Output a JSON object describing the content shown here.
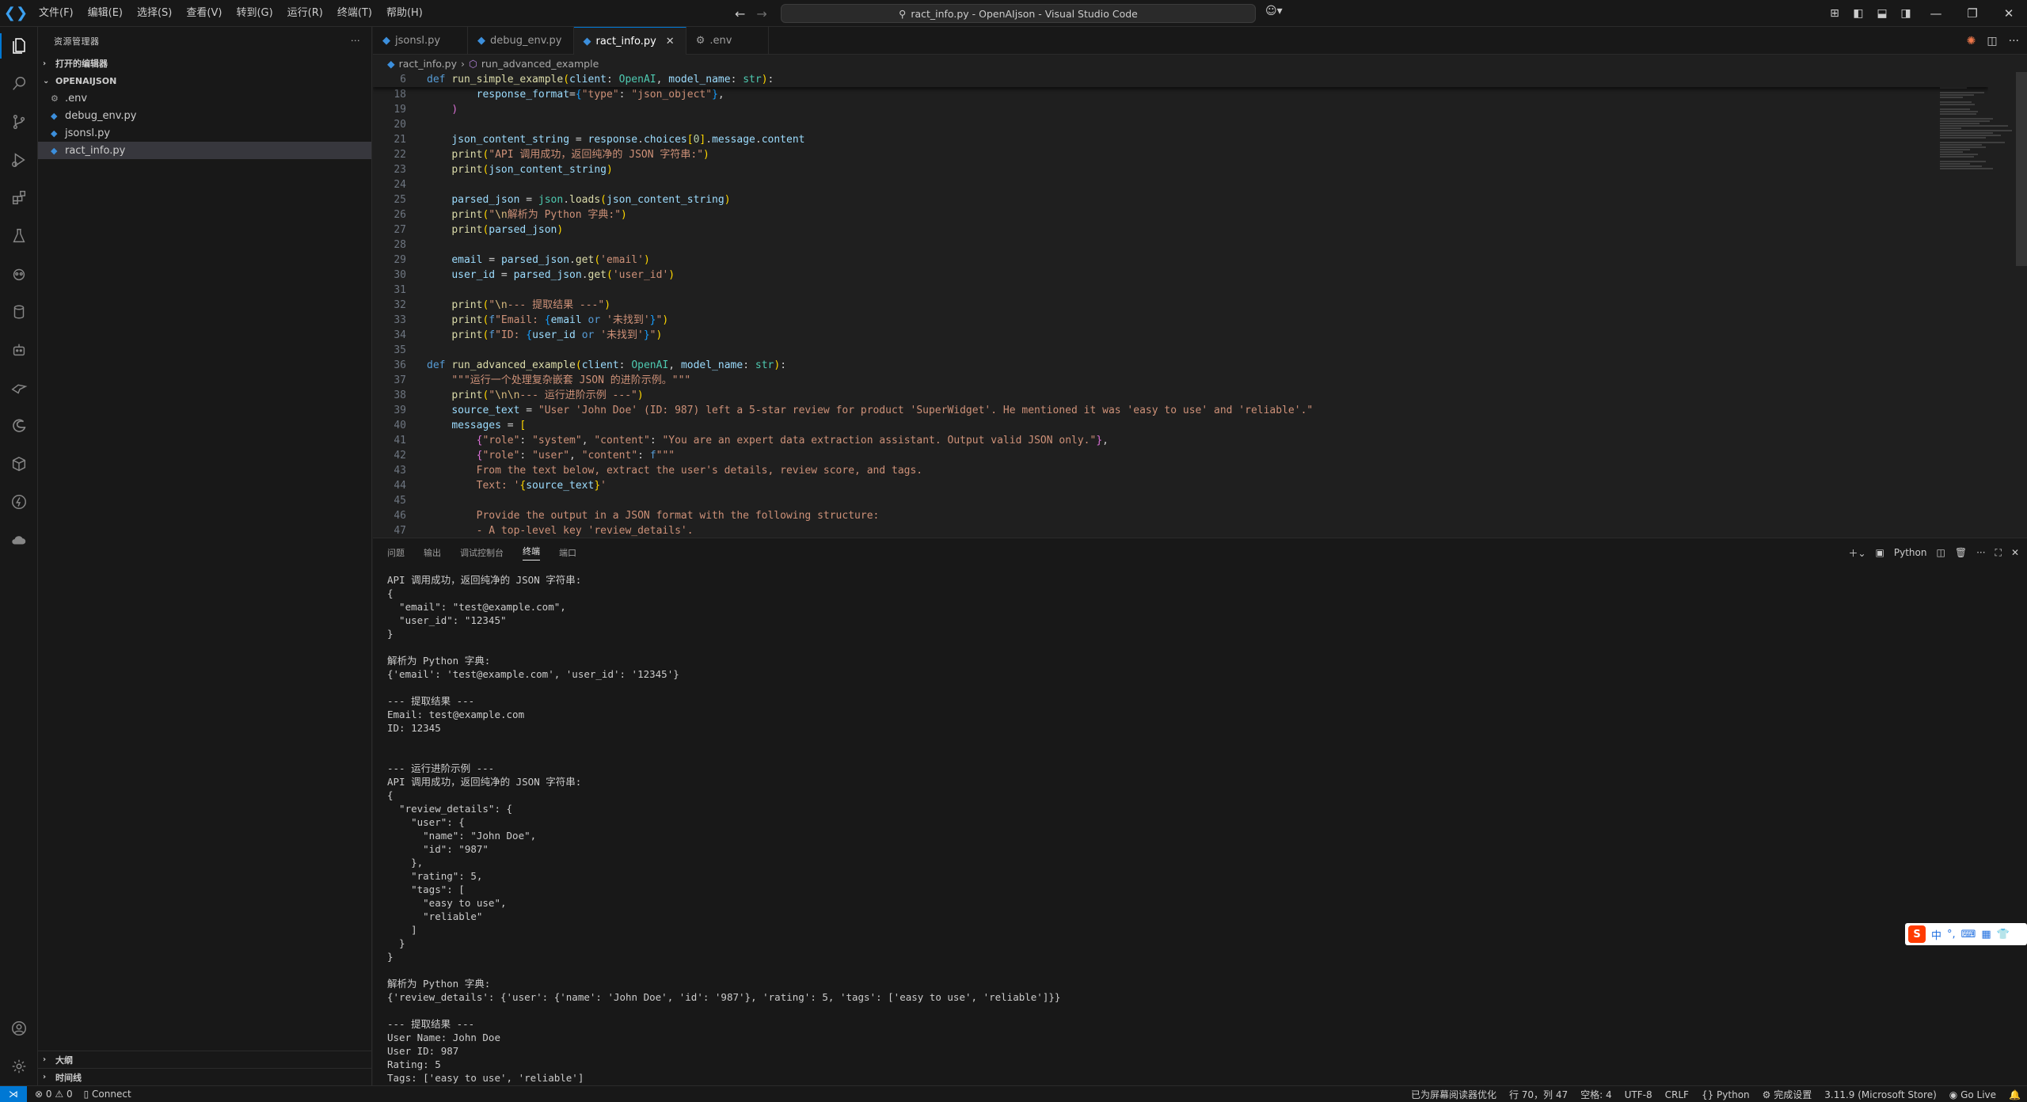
{
  "window": {
    "title": "ract_info.py - OpenAIjson - Visual Studio Code",
    "logo": "vscode-logo"
  },
  "menu": [
    "文件(F)",
    "编辑(E)",
    "选择(S)",
    "查看(V)",
    "转到(G)",
    "运行(R)",
    "终端(T)",
    "帮助(H)"
  ],
  "sidebar": {
    "header": "资源管理器",
    "open_editors": "打开的编辑器",
    "folder": "OPENAIJSON",
    "files": [
      {
        "name": ".env",
        "icon": "gear-icon"
      },
      {
        "name": "debug_env.py",
        "icon": "python-icon"
      },
      {
        "name": "jsonsl.py",
        "icon": "python-icon"
      },
      {
        "name": "ract_info.py",
        "icon": "python-icon",
        "selected": true
      }
    ],
    "outline": "大纲",
    "timeline": "时间线"
  },
  "tabs": [
    {
      "label": "jsonsl.py",
      "active": false
    },
    {
      "label": "debug_env.py",
      "active": false
    },
    {
      "label": "ract_info.py",
      "active": true
    },
    {
      "label": ".env",
      "active": false
    }
  ],
  "breadcrumb": {
    "file": "ract_info.py",
    "symbol": "run_advanced_example"
  },
  "code_lines": [
    {
      "n": "6",
      "sticky": true,
      "html": "<span class='kw'>def</span> <span class='fn'>run_simple_example</span><span class='br1'>(</span><span class='var'>client</span>: <span class='cls'>OpenAI</span>, <span class='var'>model_name</span>: <span class='cls'>str</span><span class='br1'>)</span>:"
    },
    {
      "n": "18",
      "html": "        <span class='var'>response_format</span>=<span class='br3'>{</span><span class='str'>\"type\"</span>: <span class='str'>\"json_object\"</span><span class='br3'>}</span>,"
    },
    {
      "n": "19",
      "html": "    <span class='br2'>)</span>"
    },
    {
      "n": "20",
      "html": ""
    },
    {
      "n": "21",
      "html": "    <span class='var'>json_content_string</span> = <span class='var'>response</span>.<span class='var'>choices</span><span class='br1'>[</span><span class='num'>0</span><span class='br1'>]</span>.<span class='var'>message</span>.<span class='var'>content</span>"
    },
    {
      "n": "22",
      "html": "    <span class='fn'>print</span><span class='br1'>(</span><span class='str'>\"API 调用成功，返回纯净的 JSON 字符串:\"</span><span class='br1'>)</span>"
    },
    {
      "n": "23",
      "html": "    <span class='fn'>print</span><span class='br1'>(</span><span class='var'>json_content_string</span><span class='br1'>)</span>"
    },
    {
      "n": "24",
      "html": ""
    },
    {
      "n": "25",
      "html": "    <span class='var'>parsed_json</span> = <span class='cls'>json</span>.<span class='fn'>loads</span><span class='br1'>(</span><span class='var'>json_content_string</span><span class='br1'>)</span>"
    },
    {
      "n": "26",
      "html": "    <span class='fn'>print</span><span class='br1'>(</span><span class='str'>\"</span><span class='esc'>\\n</span><span class='str'>解析为 Python 字典:\"</span><span class='br1'>)</span>"
    },
    {
      "n": "27",
      "html": "    <span class='fn'>print</span><span class='br1'>(</span><span class='var'>parsed_json</span><span class='br1'>)</span>"
    },
    {
      "n": "28",
      "html": ""
    },
    {
      "n": "29",
      "html": "    <span class='var'>email</span> = <span class='var'>parsed_json</span>.<span class='fn'>get</span><span class='br1'>(</span><span class='str'>'email'</span><span class='br1'>)</span>"
    },
    {
      "n": "30",
      "html": "    <span class='var'>user_id</span> = <span class='var'>parsed_json</span>.<span class='fn'>get</span><span class='br1'>(</span><span class='str'>'user_id'</span><span class='br1'>)</span>"
    },
    {
      "n": "31",
      "html": ""
    },
    {
      "n": "32",
      "html": "    <span class='fn'>print</span><span class='br1'>(</span><span class='str'>\"</span><span class='esc'>\\n</span><span class='str'>--- 提取结果 ---\"</span><span class='br1'>)</span>"
    },
    {
      "n": "33",
      "html": "    <span class='fn'>print</span><span class='br1'>(</span><span class='kw'>f</span><span class='str'>\"Email: </span><span class='br3'>{</span><span class='var'>email</span> <span class='kw'>or</span> <span class='str'>'未找到'</span><span class='br3'>}</span><span class='str'>\"</span><span class='br1'>)</span>"
    },
    {
      "n": "34",
      "html": "    <span class='fn'>print</span><span class='br1'>(</span><span class='kw'>f</span><span class='str'>\"ID: </span><span class='br3'>{</span><span class='var'>user_id</span> <span class='kw'>or</span> <span class='str'>'未找到'</span><span class='br3'>}</span><span class='str'>\"</span><span class='br1'>)</span>"
    },
    {
      "n": "35",
      "html": ""
    },
    {
      "n": "36",
      "html": "<span class='kw'>def</span> <span class='fn'>run_advanced_example</span><span class='br1'>(</span><span class='var'>client</span>: <span class='cls'>OpenAI</span>, <span class='var'>model_name</span>: <span class='cls'>str</span><span class='br1'>)</span>:"
    },
    {
      "n": "37",
      "html": "    <span class='str'>\"\"\"运行一个处理复杂嵌套 JSON 的进阶示例。\"\"\"</span>"
    },
    {
      "n": "38",
      "html": "    <span class='fn'>print</span><span class='br1'>(</span><span class='str'>\"</span><span class='esc'>\\n\\n</span><span class='str'>--- 运行进阶示例 ---\"</span><span class='br1'>)</span>"
    },
    {
      "n": "39",
      "html": "    <span class='var'>source_text</span> = <span class='str'>\"User 'John Doe' (ID: 987) left a 5-star review for product 'SuperWidget'. He mentioned it was 'easy to use' and 'reliable'.\"</span>"
    },
    {
      "n": "40",
      "html": "    <span class='var'>messages</span> = <span class='br1'>[</span>"
    },
    {
      "n": "41",
      "html": "        <span class='br2'>{</span><span class='str'>\"role\"</span>: <span class='str'>\"system\"</span>, <span class='str'>\"content\"</span>: <span class='str'>\"You are an expert data extraction assistant. Output valid JSON only.\"</span><span class='br2'>}</span>,"
    },
    {
      "n": "42",
      "html": "        <span class='br2'>{</span><span class='str'>\"role\"</span>: <span class='str'>\"user\"</span>, <span class='str'>\"content\"</span>: <span class='kw'>f</span><span class='str'>\"\"\"</span>"
    },
    {
      "n": "43",
      "html": "<span class='str'>        From the text below, extract the user's details, review score, and tags.</span>"
    },
    {
      "n": "44",
      "html": "<span class='str'>        Text: '</span><span class='br1'>{</span><span class='var'>source_text</span><span class='br1'>}</span><span class='str'>'</span>"
    },
    {
      "n": "45",
      "html": ""
    },
    {
      "n": "46",
      "html": "<span class='str'>        Provide the output in a JSON format with the following structure:</span>"
    },
    {
      "n": "47",
      "html": "<span class='str'>        - A top-level key 'review_details'.</span>"
    }
  ],
  "panel": {
    "tabs": [
      {
        "label": "问题",
        "active": false
      },
      {
        "label": "输出",
        "active": false
      },
      {
        "label": "调试控制台",
        "active": false
      },
      {
        "label": "终端",
        "active": true
      },
      {
        "label": "端口",
        "active": false
      }
    ],
    "terminal_name": "Python",
    "terminal_lines": [
      "API 调用成功，返回纯净的 JSON 字符串:",
      "{",
      "  \"email\": \"test@example.com\",",
      "  \"user_id\": \"12345\"",
      "}",
      "",
      "解析为 Python 字典:",
      "{'email': 'test@example.com', 'user_id': '12345'}",
      "",
      "--- 提取结果 ---",
      "Email: test@example.com",
      "ID: 12345",
      "",
      "",
      "--- 运行进阶示例 ---",
      "API 调用成功，返回纯净的 JSON 字符串:",
      "{",
      "  \"review_details\": {",
      "    \"user\": {",
      "      \"name\": \"John Doe\",",
      "      \"id\": \"987\"",
      "    },",
      "    \"rating\": 5,",
      "    \"tags\": [",
      "      \"easy to use\",",
      "      \"reliable\"",
      "    ]",
      "  }",
      "}",
      "",
      "解析为 Python 字典:",
      "{'review_details': {'user': {'name': 'John Doe', 'id': '987'}, 'rating': 5, 'tags': ['easy to use', 'reliable']}}",
      "",
      "--- 提取结果 ---",
      "User Name: John Doe",
      "User ID: 987",
      "Rating: 5",
      "Tags: ['easy to use', 'reliable']"
    ]
  },
  "ime": {
    "logo": "S",
    "lang": "中",
    "punct": "°,"
  },
  "statusbar": {
    "errors": "0",
    "warnings": "0",
    "connect": "Connect",
    "screen_reader": "已为屏幕阅读器优化",
    "position": "行 70，列 47",
    "spaces": "空格: 4",
    "encoding": "UTF-8",
    "eol": "CRLF",
    "language": "Python",
    "settings": "完成设置",
    "interpreter": "3.11.9 (Microsoft Store)",
    "golive": "Go Live"
  }
}
